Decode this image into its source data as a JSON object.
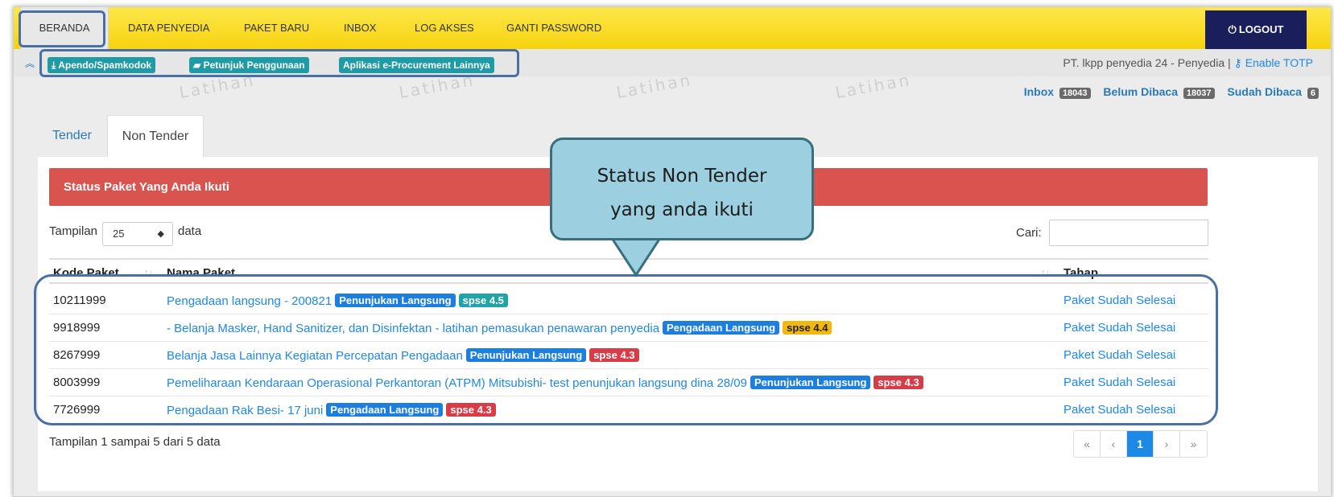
{
  "nav": {
    "items": [
      "BERANDA",
      "DATA PENYEDIA",
      "PAKET BARU",
      "INBOX",
      "LOG AKSES",
      "GANTI PASSWORD"
    ],
    "logout_label": "LOGOUT"
  },
  "subbar": {
    "buttons": [
      "Apendo/Spamkodok",
      "Petunjuk Penggunaan",
      "Aplikasi e-Procurement Lainnya"
    ],
    "user": "PT. lkpp penyedia 24 - Penyedia |",
    "enable_totp": "Enable TOTP"
  },
  "watermark": "Latihan",
  "inbox": {
    "inbox_label": "Inbox",
    "inbox_count": "18043",
    "unread_label": "Belum Dibaca",
    "unread_count": "18037",
    "read_label": "Sudah Dibaca",
    "read_count": "6"
  },
  "tabs": [
    "Tender",
    "Non Tender"
  ],
  "panel": {
    "title": "Status Paket Yang Anda Ikuti",
    "length_label": "Tampilan",
    "length_value": "25",
    "length_after": "data",
    "search_label": "Cari:",
    "columns": [
      "Kode Paket",
      "Nama Paket",
      "Tahap"
    ],
    "rows": [
      {
        "kode": "10211999",
        "nama": "Pengadaan langsung - 200821",
        "metode": "Penunjukan Langsung",
        "versi": "spse 4.5",
        "tahap": "Paket Sudah Selesai"
      },
      {
        "kode": "9918999",
        "nama": "- Belanja Masker, Hand Sanitizer, dan Disinfektan - latihan pemasukan penawaran penyedia",
        "metode": "Pengadaan Langsung",
        "versi": "spse 4.4",
        "tahap": "Paket Sudah Selesai"
      },
      {
        "kode": "8267999",
        "nama": "Belanja Jasa Lainnya Kegiatan Percepatan Pengadaan",
        "metode": "Penunjukan Langsung",
        "versi": "spse 4.3",
        "tahap": "Paket Sudah Selesai"
      },
      {
        "kode": "8003999",
        "nama": "Pemeliharaan Kendaraan Operasional Perkantoran (ATPM) Mitsubishi- test penunjukan langsung dina 28/09",
        "metode": "Penunjukan Langsung",
        "versi": "spse 4.3",
        "tahap": "Paket Sudah Selesai"
      },
      {
        "kode": "7726999",
        "nama": "Pengadaan Rak Besi- 17 juni",
        "metode": "Pengadaan Langsung",
        "versi": "spse 4.3",
        "tahap": "Paket Sudah Selesai"
      }
    ],
    "info": "Tampilan 1 sampai 5 dari 5 data",
    "pager": [
      "«",
      "‹",
      "1",
      "›",
      "»"
    ]
  },
  "callout": {
    "line1": "Status Non Tender",
    "line2": "yang anda ikuti"
  },
  "colors": {
    "nav_bg": "#fde02a",
    "logout_bg": "#1a1f5c",
    "status_bar": "#d9534f",
    "link": "#1e88e5",
    "callout_bg": "#9cd0e0",
    "highlight_border": "#4a6fa5"
  }
}
